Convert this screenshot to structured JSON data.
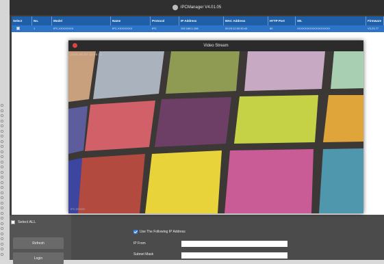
{
  "app": {
    "title": "IPCManager V4.01.05"
  },
  "table": {
    "columns": [
      "Select",
      "No.",
      "Model",
      "Name",
      "Protocol",
      "IP Address",
      "MAC Address",
      "HTTP Port",
      "SN.",
      "Firmware"
    ],
    "rows": [
      [
        "",
        "1",
        "IPC-XXXXXXXX",
        "IPC-XXXXXXXX",
        "IPC",
        "192.168.1.108",
        "00:23:12:30:30:43",
        "80",
        "XXXXXXXXXXXXXXXXXX",
        "V3.23.77"
      ]
    ]
  },
  "video_window": {
    "title": "Video Stream",
    "timestamp": "2016-05-02 14:38:21",
    "bottom_mark": "IPC-000000"
  },
  "controls": {
    "select_all": "Select ALL",
    "refresh": "Refresh",
    "login": "Login"
  },
  "ip_config": {
    "use_following": "Use The Following IP Address",
    "ip_from_label": "IP From",
    "subnet_mask_label": "Subnet Mask"
  },
  "colors": {
    "header_blue": "#1f5fa8",
    "selected_row_blue": "#2d73c8",
    "checkbox_accent": "#2f7fe0",
    "close_button_red": "#e0443e"
  }
}
